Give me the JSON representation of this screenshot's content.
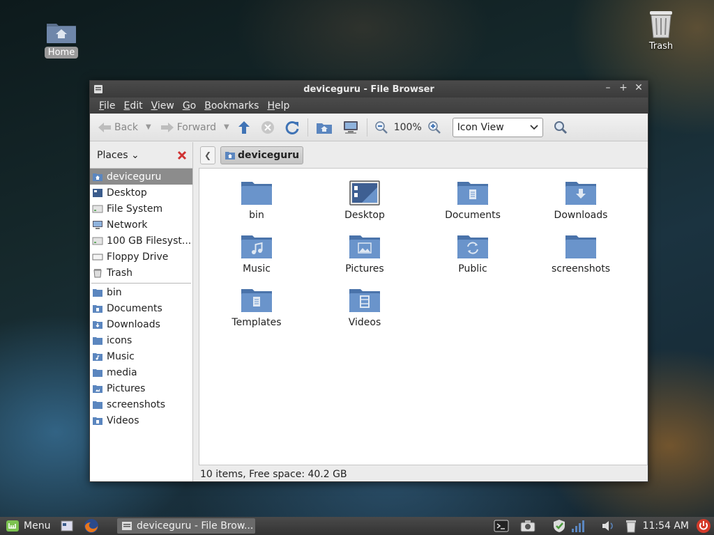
{
  "desktop": {
    "home_label": "Home",
    "trash_label": "Trash"
  },
  "window": {
    "title": "deviceguru - File Browser",
    "menu": [
      "File",
      "Edit",
      "View",
      "Go",
      "Bookmarks",
      "Help"
    ],
    "toolbar": {
      "back_label": "Back",
      "forward_label": "Forward",
      "zoom_value": "100%",
      "view_mode": "Icon View"
    },
    "sidebar": {
      "header_label": "Places",
      "places": [
        {
          "label": "deviceguru",
          "icon": "home-folder-icon",
          "selected": true
        },
        {
          "label": "Desktop",
          "icon": "desktop-icon"
        },
        {
          "label": "File System",
          "icon": "drive-icon"
        },
        {
          "label": "Network",
          "icon": "network-icon"
        },
        {
          "label": "100 GB Filesyst...",
          "icon": "drive-icon"
        },
        {
          "label": "Floppy Drive",
          "icon": "floppy-icon"
        },
        {
          "label": "Trash",
          "icon": "trash-icon"
        }
      ],
      "bookmarks": [
        {
          "label": "bin"
        },
        {
          "label": "Documents"
        },
        {
          "label": "Downloads"
        },
        {
          "label": "icons"
        },
        {
          "label": "Music"
        },
        {
          "label": "media"
        },
        {
          "label": "Pictures"
        },
        {
          "label": "screenshots"
        },
        {
          "label": "Videos"
        }
      ]
    },
    "pathbar": {
      "current": "deviceguru"
    },
    "files": [
      {
        "name": "bin",
        "icon": "folder-icon"
      },
      {
        "name": "Desktop",
        "icon": "desktop-folder-icon"
      },
      {
        "name": "Documents",
        "icon": "documents-folder-icon"
      },
      {
        "name": "Downloads",
        "icon": "downloads-folder-icon"
      },
      {
        "name": "Music",
        "icon": "music-folder-icon"
      },
      {
        "name": "Pictures",
        "icon": "pictures-folder-icon"
      },
      {
        "name": "Public",
        "icon": "public-folder-icon"
      },
      {
        "name": "screenshots",
        "icon": "folder-icon"
      },
      {
        "name": "Templates",
        "icon": "templates-folder-icon"
      },
      {
        "name": "Videos",
        "icon": "videos-folder-icon"
      }
    ],
    "status": "10 items, Free space: 40.2 GB"
  },
  "taskbar": {
    "menu_label": "Menu",
    "task_label": "deviceguru - File Brow...",
    "clock": "11:54 AM"
  },
  "colors": {
    "folder_blue": "#5b86bf",
    "selection_gray": "#8c8c8c",
    "power_red": "#d43a2a"
  }
}
